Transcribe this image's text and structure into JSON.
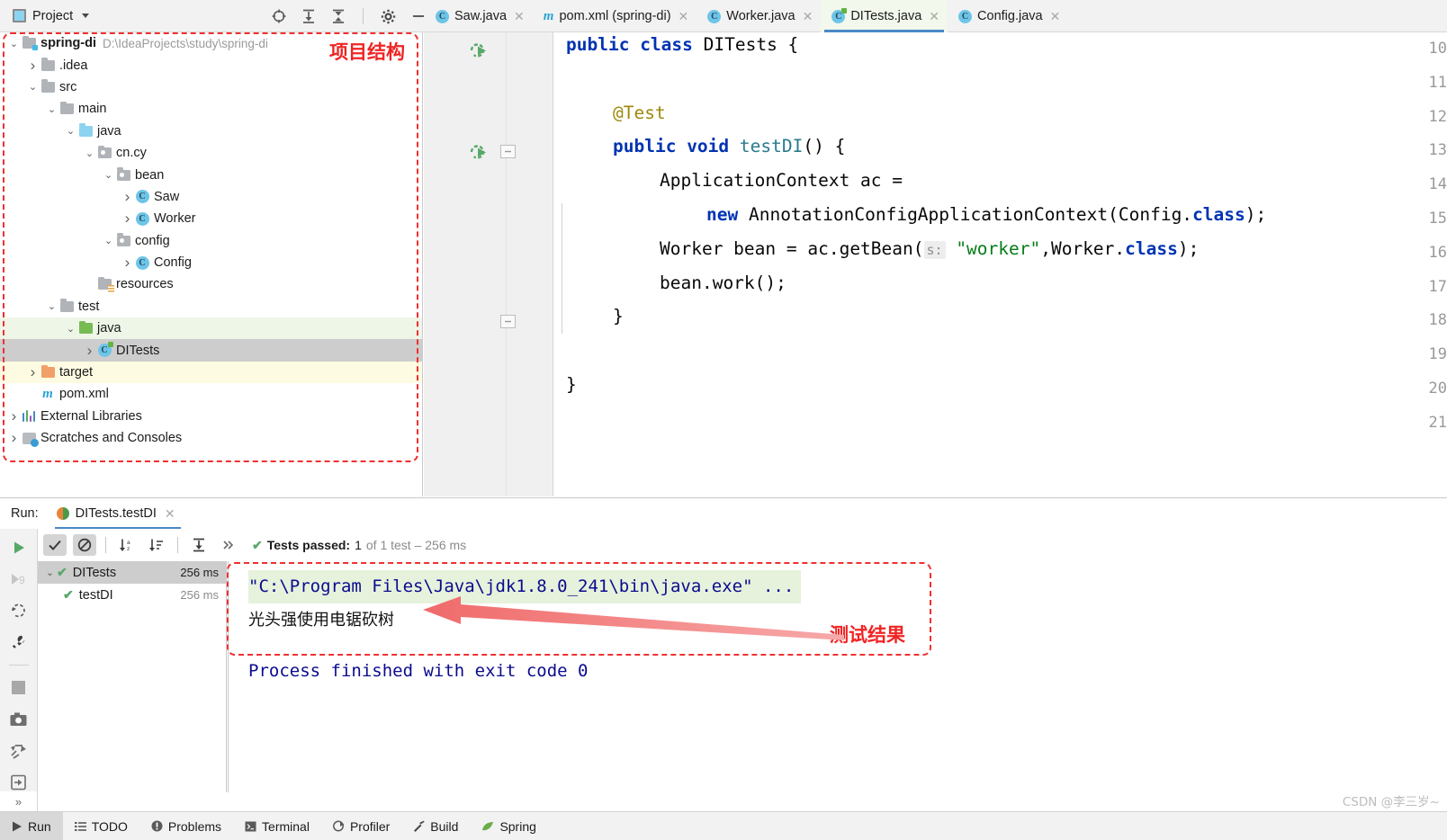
{
  "topbar": {
    "project_label": "Project",
    "icons": [
      "locate-icon",
      "expand-all-icon",
      "collapse-all-icon",
      "settings-gear-icon",
      "minimize-icon"
    ]
  },
  "tabs": [
    {
      "label": "Saw.java",
      "icon": "java-class-icon",
      "active": false,
      "closable": true
    },
    {
      "label": "pom.xml (spring-di)",
      "icon": "maven-icon",
      "active": false,
      "closable": true
    },
    {
      "label": "Worker.java",
      "icon": "java-class-icon",
      "active": false,
      "closable": true
    },
    {
      "label": "DITests.java",
      "icon": "java-test-class-icon",
      "active": true,
      "closable": true
    },
    {
      "label": "Config.java",
      "icon": "java-class-icon",
      "active": false,
      "closable": true
    }
  ],
  "project_tree": [
    {
      "label": "spring-di",
      "sub": "D:\\IdeaProjects\\study\\spring-di",
      "indent": 0,
      "arrow": "down",
      "icon": "module-folder-icon",
      "bold": true,
      "state": ""
    },
    {
      "label": ".idea",
      "sub": "",
      "indent": 1,
      "arrow": "right",
      "icon": "folder-icon",
      "bold": false,
      "state": ""
    },
    {
      "label": "src",
      "sub": "",
      "indent": 1,
      "arrow": "down",
      "icon": "folder-icon",
      "bold": false,
      "state": ""
    },
    {
      "label": "main",
      "sub": "",
      "indent": 2,
      "arrow": "down",
      "icon": "folder-icon",
      "bold": false,
      "state": ""
    },
    {
      "label": "java",
      "sub": "",
      "indent": 3,
      "arrow": "down",
      "icon": "source-root-folder-icon",
      "bold": false,
      "state": ""
    },
    {
      "label": "cn.cy",
      "sub": "",
      "indent": 4,
      "arrow": "down",
      "icon": "package-icon",
      "bold": false,
      "state": ""
    },
    {
      "label": "bean",
      "sub": "",
      "indent": 5,
      "arrow": "down",
      "icon": "package-icon",
      "bold": false,
      "state": ""
    },
    {
      "label": "Saw",
      "sub": "",
      "indent": 6,
      "arrow": "right",
      "icon": "java-class-icon",
      "bold": false,
      "state": ""
    },
    {
      "label": "Worker",
      "sub": "",
      "indent": 6,
      "arrow": "right",
      "icon": "java-class-icon",
      "bold": false,
      "state": ""
    },
    {
      "label": "config",
      "sub": "",
      "indent": 5,
      "arrow": "down",
      "icon": "package-icon",
      "bold": false,
      "state": ""
    },
    {
      "label": "Config",
      "sub": "",
      "indent": 6,
      "arrow": "right",
      "icon": "java-class-icon",
      "bold": false,
      "state": ""
    },
    {
      "label": "resources",
      "sub": "",
      "indent": 4,
      "arrow": "none",
      "icon": "resources-folder-icon",
      "bold": false,
      "state": ""
    },
    {
      "label": "test",
      "sub": "",
      "indent": 2,
      "arrow": "down",
      "icon": "folder-icon",
      "bold": false,
      "state": ""
    },
    {
      "label": "java",
      "sub": "",
      "indent": 3,
      "arrow": "down",
      "icon": "test-source-root-folder-icon",
      "bold": false,
      "state": "green"
    },
    {
      "label": "DITests",
      "sub": "",
      "indent": 4,
      "arrow": "right",
      "icon": "java-test-class-icon",
      "bold": false,
      "state": "gray"
    },
    {
      "label": "target",
      "sub": "",
      "indent": 1,
      "arrow": "right",
      "icon": "excluded-folder-icon",
      "bold": false,
      "state": "yellow"
    },
    {
      "label": "pom.xml",
      "sub": "",
      "indent": 1,
      "arrow": "none",
      "icon": "maven-icon",
      "bold": false,
      "state": ""
    },
    {
      "label": "External Libraries",
      "sub": "",
      "indent": 0,
      "arrow": "right",
      "icon": "libraries-icon",
      "bold": false,
      "state": ""
    },
    {
      "label": "Scratches and Consoles",
      "sub": "",
      "indent": 0,
      "arrow": "right",
      "icon": "scratches-icon",
      "bold": false,
      "state": ""
    }
  ],
  "editor": {
    "line_numbers": [
      "10",
      "11",
      "12",
      "13",
      "14",
      "15",
      "16",
      "17",
      "18",
      "19",
      "20",
      "21"
    ],
    "run_marker_lines": [
      "10",
      "13"
    ],
    "code_lines": [
      {
        "num": "10",
        "indent": 0,
        "tokens": [
          {
            "t": "public ",
            "c": "kw"
          },
          {
            "t": "class ",
            "c": "kw"
          },
          {
            "t": "DITests {",
            "c": "pln"
          }
        ]
      },
      {
        "num": "11",
        "indent": 0,
        "tokens": []
      },
      {
        "num": "12",
        "indent": 1,
        "tokens": [
          {
            "t": "@Test",
            "c": "ann"
          }
        ]
      },
      {
        "num": "13",
        "indent": 1,
        "tokens": [
          {
            "t": "public ",
            "c": "kw"
          },
          {
            "t": "void ",
            "c": "kw"
          },
          {
            "t": "testDI",
            "c": "mth"
          },
          {
            "t": "() {",
            "c": "pln"
          }
        ]
      },
      {
        "num": "14",
        "indent": 2,
        "tokens": [
          {
            "t": "ApplicationContext ac =",
            "c": "pln"
          }
        ]
      },
      {
        "num": "15",
        "indent": 3,
        "tokens": [
          {
            "t": "new ",
            "c": "kw"
          },
          {
            "t": "AnnotationConfigApplicationContext(Config.",
            "c": "pln"
          },
          {
            "t": "class",
            "c": "kw"
          },
          {
            "t": ");",
            "c": "pln"
          }
        ]
      },
      {
        "num": "16",
        "indent": 2,
        "tokens": [
          {
            "t": "Worker bean = ac.getBean(",
            "c": "pln"
          },
          {
            "t": "s:",
            "c": "hint"
          },
          {
            "t": " ",
            "c": "pln"
          },
          {
            "t": "\"worker\"",
            "c": "str"
          },
          {
            "t": ",Worker.",
            "c": "pln"
          },
          {
            "t": "class",
            "c": "kw"
          },
          {
            "t": ");",
            "c": "pln"
          }
        ]
      },
      {
        "num": "17",
        "indent": 2,
        "tokens": [
          {
            "t": "bean.work();",
            "c": "pln"
          }
        ]
      },
      {
        "num": "18",
        "indent": 1,
        "tokens": [
          {
            "t": "}",
            "c": "pln"
          }
        ]
      },
      {
        "num": "19",
        "indent": 0,
        "tokens": []
      },
      {
        "num": "20",
        "indent": 0,
        "tokens": [
          {
            "t": "}",
            "c": "pln"
          }
        ]
      },
      {
        "num": "21",
        "indent": 0,
        "tokens": []
      }
    ]
  },
  "run_panel": {
    "run_label": "Run:",
    "run_tab_label": "DITests.testDI",
    "toolbar": {
      "buttons": [
        "show-passed-icon",
        "hide-ignored-icon",
        "sort-alphabetically-icon",
        "sort-by-duration-icon",
        "expand-collapse-icon",
        "more-icon"
      ],
      "status_prefix": "Tests passed:",
      "status_count": "1",
      "status_suffix": "of 1 test – 256 ms"
    },
    "left_icons": [
      "rerun-icon",
      "rerun-failed-icon",
      "rerun-auto-icon",
      "settings-wrench-icon",
      "stop-icon",
      "screenshot-icon",
      "import-tests-icon",
      "export-tests-icon"
    ],
    "test_tree": [
      {
        "label": "DITests",
        "time": "256 ms",
        "indent": 0,
        "arrow": "down",
        "selected": true
      },
      {
        "label": "testDI",
        "time": "256 ms",
        "indent": 1,
        "arrow": "none",
        "selected": false
      }
    ],
    "console": [
      {
        "text": "\"C:\\Program Files\\Java\\jdk1.8.0_241\\bin\\java.exe\" ...",
        "style": "highlight"
      },
      {
        "text": "光头强使用电锯砍树",
        "style": "chinese"
      },
      {
        "text": "",
        "style": "blank"
      },
      {
        "text": "Process finished with exit code 0",
        "style": "normal"
      }
    ]
  },
  "status_bar": {
    "items": [
      {
        "label": "Run",
        "icon": "play-icon",
        "active": true
      },
      {
        "label": "TODO",
        "icon": "todo-list-icon",
        "active": false
      },
      {
        "label": "Problems",
        "icon": "problems-icon",
        "active": false
      },
      {
        "label": "Terminal",
        "icon": "terminal-icon",
        "active": false
      },
      {
        "label": "Profiler",
        "icon": "profiler-icon",
        "active": false
      },
      {
        "label": "Build",
        "icon": "build-hammer-icon",
        "active": false
      },
      {
        "label": "Spring",
        "icon": "spring-leaf-icon",
        "active": false
      }
    ],
    "collapse_label": "»",
    "watermark": "CSDN @李三岁~"
  },
  "annotations": {
    "project_structure_label": "项目结构",
    "test_result_label": "测试结果",
    "color": "#f02424"
  }
}
